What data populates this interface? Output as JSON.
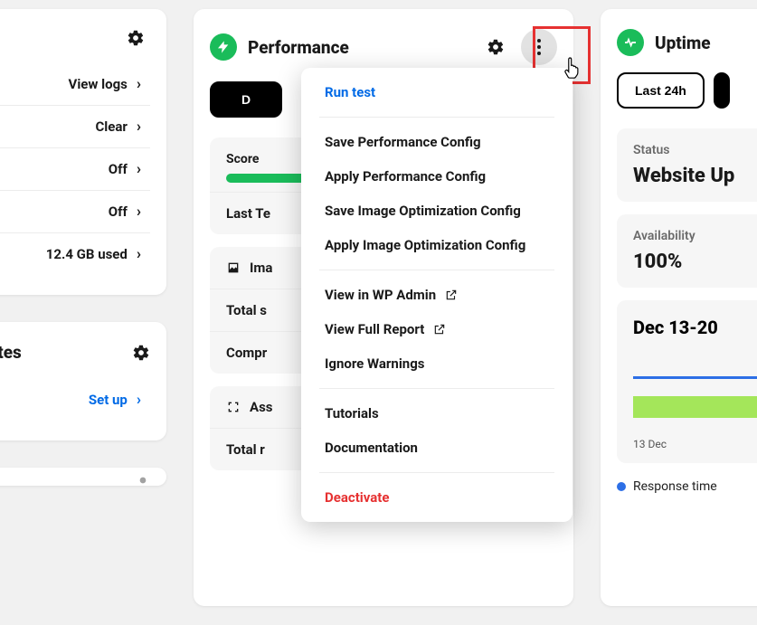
{
  "left_card_a": {
    "items": [
      {
        "label": "View logs"
      },
      {
        "label": "Clear"
      },
      {
        "label": "Off"
      },
      {
        "label": "Off"
      },
      {
        "label": "12.4 GB used"
      }
    ]
  },
  "left_card_b": {
    "title_fragment": "lates",
    "action_label": "Set up"
  },
  "performance": {
    "title": "Performance",
    "primary_button_fragment": "D",
    "score_label": "Score",
    "last_test_label": "Last Te",
    "image_row_label": "Ima",
    "total_s_label": "Total s",
    "compression_label": "Compr",
    "assets_label": "Ass",
    "total_r_label": "Total r"
  },
  "uptime": {
    "title": "Uptime",
    "range_button": "Last 24h",
    "status_label": "Status",
    "status_value": "Website Up",
    "availability_label": "Availability",
    "availability_value": "100%",
    "chart_title": "Dec 13-20",
    "chart_xlabel": "13 Dec",
    "legend_response": "Response time"
  },
  "dropdown": {
    "run_test": "Run test",
    "save_perf": "Save Performance Config",
    "apply_perf": "Apply Performance Config",
    "save_img": "Save Image Optimization Config",
    "apply_img": "Apply Image Optimization Config",
    "view_wp": "View in WP Admin",
    "view_report": "View Full Report",
    "ignore": "Ignore Warnings",
    "tutorials": "Tutorials",
    "docs": "Documentation",
    "deactivate": "Deactivate"
  },
  "colors": {
    "accent_green": "#1abc5a",
    "accent_blue": "#006ae6",
    "danger": "#e63131",
    "highlight": "#e63131",
    "chart_line": "#2d6fe6",
    "chart_bar": "#a4e65a"
  }
}
